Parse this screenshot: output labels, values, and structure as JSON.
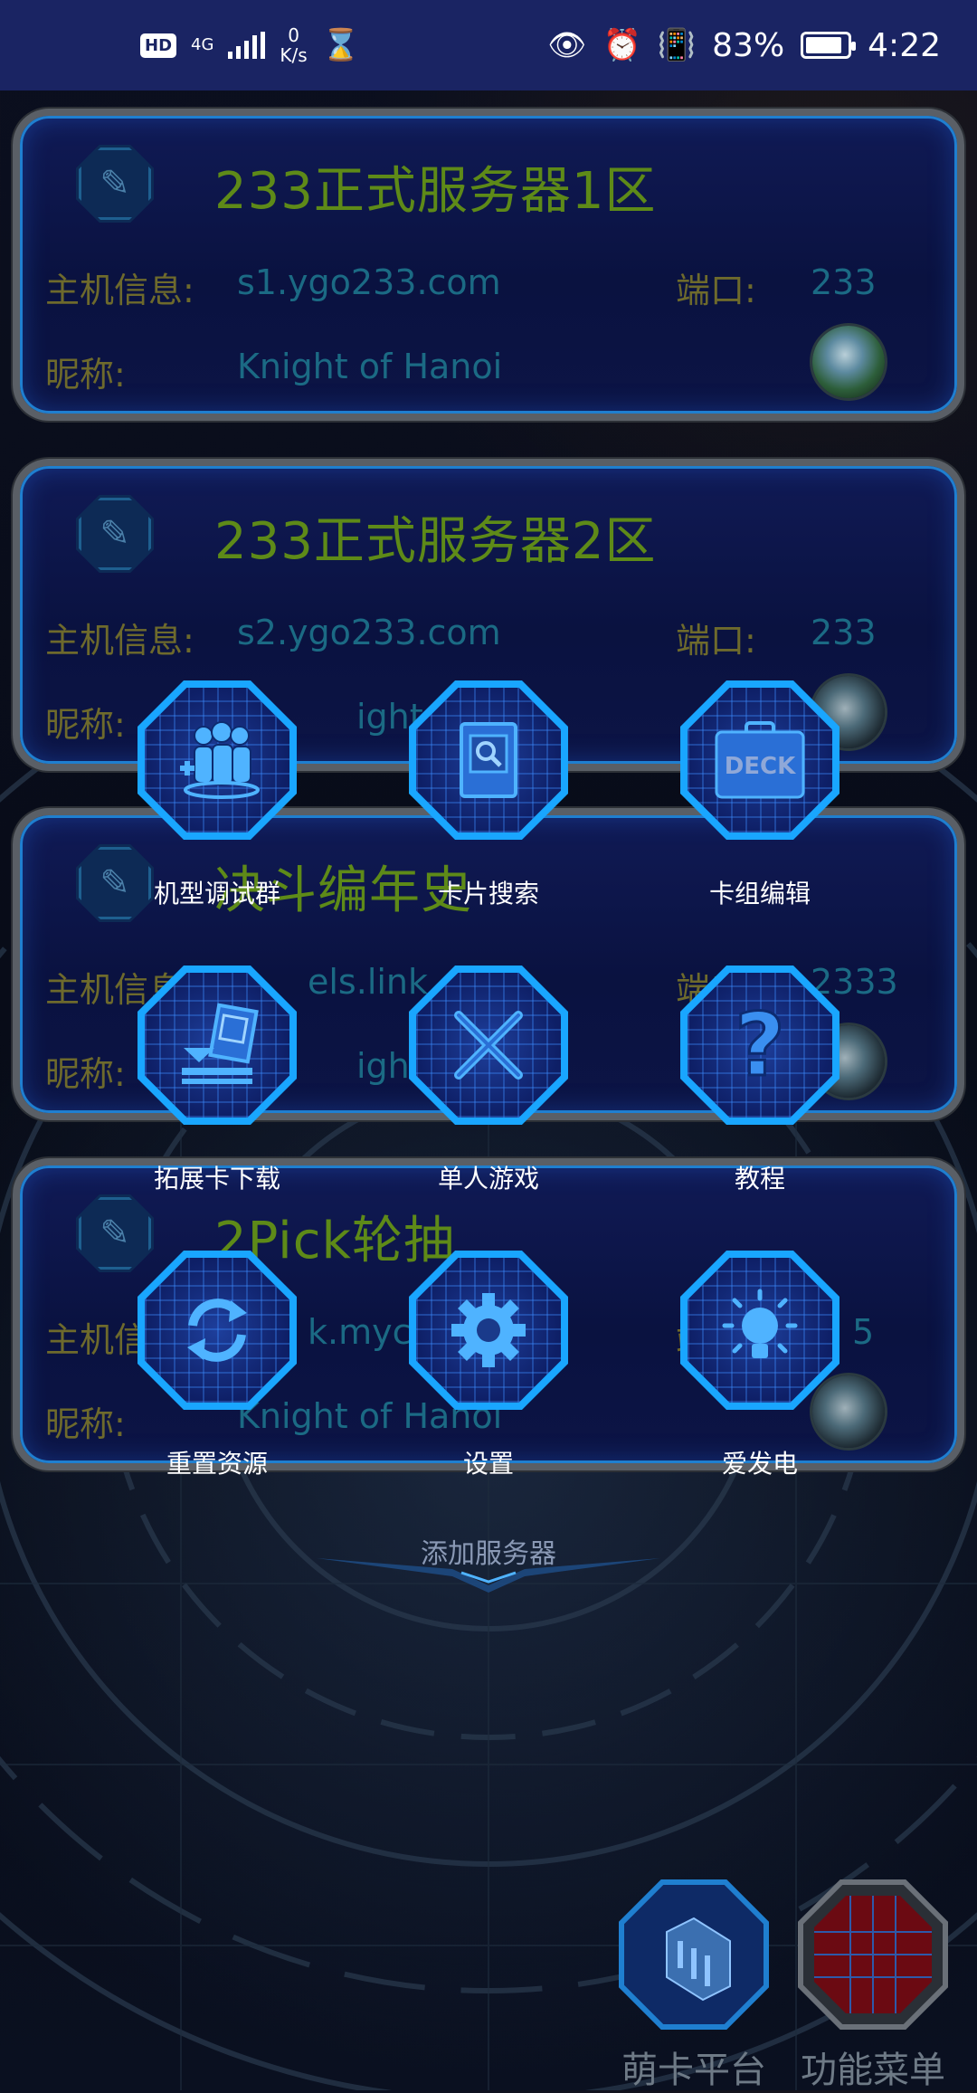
{
  "status_bar": {
    "hd_badge": "HD",
    "network": "4G",
    "net_speed_value": "0",
    "net_speed_unit": "K/s",
    "battery_percent": "83%",
    "time": "4:22"
  },
  "servers": [
    {
      "title": "233正式服务器1区",
      "host_label": "主机信息:",
      "host": "s1.ygo233.com",
      "port_label": "端口:",
      "port": "233",
      "nickname_label": "昵称:",
      "nickname": "Knight of Hanoi"
    },
    {
      "title": "233正式服务器2区",
      "host_label": "主机信息:",
      "host": "s2.ygo233.com",
      "port_label": "端口:",
      "port": "233",
      "nickname_label": "昵称:",
      "nickname": "ight of H"
    },
    {
      "title": "决斗编年史",
      "host_label": "主机信息",
      "host": "els.link",
      "port_label": "端口",
      "port": "2333",
      "nickname_label": "昵称:",
      "nickname": "ight of H"
    },
    {
      "title": "2Pick轮抽",
      "host_label": "主机信",
      "host": "k.myca",
      "port_label": "端",
      "port": "5",
      "nickname_label": "昵称:",
      "nickname": "Knight of Hanoi"
    }
  ],
  "menu": {
    "items": [
      {
        "label": "机型调试群",
        "icon": "group-add-icon"
      },
      {
        "label": "卡片搜索",
        "icon": "card-search-icon"
      },
      {
        "label": "卡组编辑",
        "icon": "deck-icon",
        "icon_text": "DECK"
      },
      {
        "label": "拓展卡下载",
        "icon": "card-download-icon"
      },
      {
        "label": "单人游戏",
        "icon": "crossed-swords-icon"
      },
      {
        "label": "教程",
        "icon": "question-icon",
        "icon_text": "?"
      },
      {
        "label": "重置资源",
        "icon": "refresh-icon"
      },
      {
        "label": "设置",
        "icon": "gear-icon"
      },
      {
        "label": "爱发电",
        "icon": "lightbulb-icon"
      }
    ]
  },
  "add_server": {
    "label": "添加服务器"
  },
  "bottom": {
    "platform_label": "萌卡平台",
    "menu_label": "功能菜单"
  },
  "colors": {
    "statusbar": "#1a2463",
    "title_green": "#5e8a18",
    "label_olive": "#6e6a2c",
    "value_teal": "#1b6a84",
    "accent_blue": "#19a6ff"
  }
}
